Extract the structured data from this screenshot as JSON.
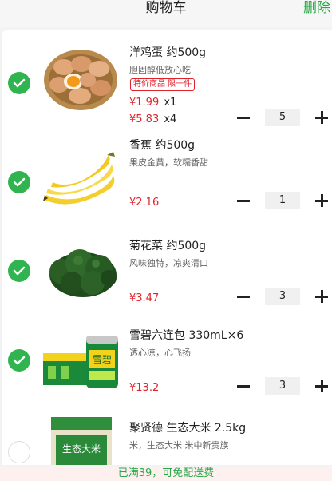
{
  "header": {
    "title": "购物车",
    "delete_label": "删除"
  },
  "items": [
    {
      "name": "洋鸡蛋 约500g",
      "desc": "胆固醇低放心吃",
      "tag": "特价商品 限一件",
      "promo_price": "¥1.99",
      "promo_mul": "x1",
      "price": "¥5.83",
      "price_mul": "x4",
      "quantity": "5",
      "checked": true
    },
    {
      "name": "香蕉 约500g",
      "desc": "果皮金黄，软糯香甜",
      "price": "¥2.16",
      "quantity": "1",
      "checked": true
    },
    {
      "name": "菊花菜 约500g",
      "desc": "风味独特，凉爽清口",
      "price": "¥3.47",
      "quantity": "3",
      "checked": true
    },
    {
      "name": "雪碧六连包 330mL×6",
      "desc": "透心凉，心飞扬",
      "price": "¥13.2",
      "quantity": "3",
      "checked": true,
      "thumb_text": "雪碧"
    },
    {
      "name": "聚贤德 生态大米 2.5kg",
      "desc": "米，生态大米 米中新贵族",
      "checked": false,
      "thumb_text": "生态大米"
    }
  ],
  "footer": {
    "text": "已满39，可免配送费"
  },
  "colors": {
    "accent": "#2fb44f",
    "price": "#e0232b"
  }
}
